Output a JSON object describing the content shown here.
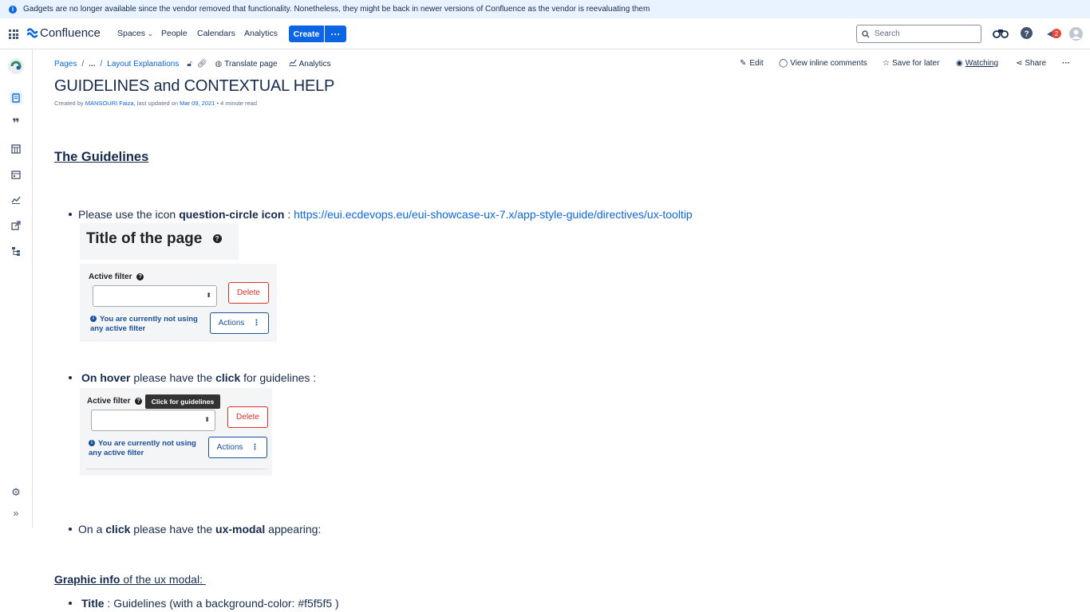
{
  "banner": {
    "text": "Gadgets are no longer available since the vendor removed that functionality. Nonetheless, they might be back in newer versions of Confluence as the vendor is reevaluating them"
  },
  "header": {
    "app_name": "Confluence",
    "nav": [
      "Spaces",
      "People",
      "Calendars",
      "Analytics"
    ],
    "create_label": "Create",
    "more_label": "···",
    "search_placeholder": "Search",
    "notification_count": "2",
    "colors": {
      "brand": "#0c66e4",
      "notification": "#e2483d"
    }
  },
  "breadcrumb": {
    "items": [
      "Pages",
      "/",
      "...",
      "/",
      "Layout Explanations"
    ],
    "translate_label": "Translate page",
    "analytics_label": "Analytics"
  },
  "page_actions": {
    "edit": "Edit",
    "comments": "View inline comments",
    "save": "Save for later",
    "watching": "Watching",
    "share": "Share",
    "more": "···"
  },
  "page": {
    "title": "GUIDELINES and CONTEXTUAL HELP",
    "byline_prefix": "Created by ",
    "author": "MANSOURI Faiza",
    "byline_mid": ", last updated on ",
    "date": "Mar 09, 2021",
    "byline_suffix": " • 4 minute read"
  },
  "content": {
    "heading": "The Guidelines ",
    "bullet1": {
      "pre": "Please use the icon ",
      "bold": "question-circle icon",
      "mid": " : ",
      "link": "https://eui.ecdevops.eu/eui-showcase-ux-7.x/app-style-guide/directives/ux-tooltip"
    },
    "mock_title": "Title of the page",
    "mock": {
      "label": "Active filter",
      "delete": "Delete",
      "actions": "Actions",
      "info_line1": "You are currently not using",
      "info_line2": "any active filter",
      "tooltip": "Click for guidelines"
    },
    "bullet2": {
      "bold1": "On hover",
      "mid": " please have the ",
      "bold2": "click",
      "post": " for guidelines :"
    },
    "bullet3": {
      "pre": "On a ",
      "bold1": "click",
      "mid": " please have the ",
      "bold2": "ux-modal",
      "post": " appearing:"
    },
    "graphic_heading": {
      "bold": "Graphic info",
      "rest": " of the ux modal: "
    },
    "bullet4": {
      "bold": "Title",
      "rest": " : Guidelines (with a background-color: #f5f5f5 )"
    }
  }
}
